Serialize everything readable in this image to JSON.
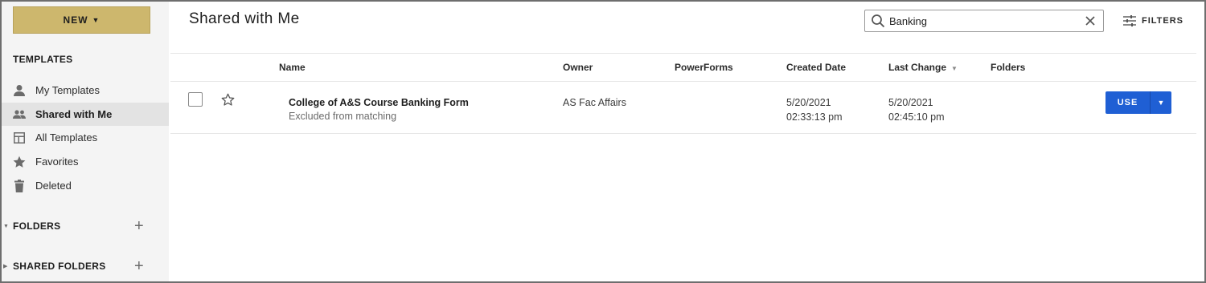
{
  "sidebar": {
    "new_button": "NEW",
    "templates_title": "TEMPLATES",
    "items": [
      {
        "label": "My Templates",
        "icon": "person-icon"
      },
      {
        "label": "Shared with Me",
        "icon": "people-icon"
      },
      {
        "label": "All Templates",
        "icon": "template-icon"
      },
      {
        "label": "Favorites",
        "icon": "star-icon"
      },
      {
        "label": "Deleted",
        "icon": "trash-icon"
      }
    ],
    "active_item": "Shared with Me",
    "folders_label": "FOLDERS",
    "shared_folders_label": "SHARED FOLDERS"
  },
  "header": {
    "title": "Shared with Me",
    "search_value": "Banking",
    "filters_label": "FILTERS"
  },
  "table": {
    "columns": [
      "Name",
      "Owner",
      "PowerForms",
      "Created Date",
      "Last Change",
      "Folders"
    ],
    "sorted_column": "Last Change",
    "rows": [
      {
        "name": "College of A&S Course Banking Form",
        "subtitle": "Excluded from matching",
        "owner": "AS Fac Affairs",
        "powerforms": "",
        "created_date": "5/20/2021",
        "created_time": "02:33:13 pm",
        "last_change_date": "5/20/2021",
        "last_change_time": "02:45:10 pm",
        "folders": "",
        "action_label": "USE"
      }
    ]
  },
  "colors": {
    "new_button": "#cdb76d",
    "use_button": "#1f5fd4",
    "sidebar_bg": "#f4f4f4",
    "active_item_bg": "#e3e3e3"
  }
}
